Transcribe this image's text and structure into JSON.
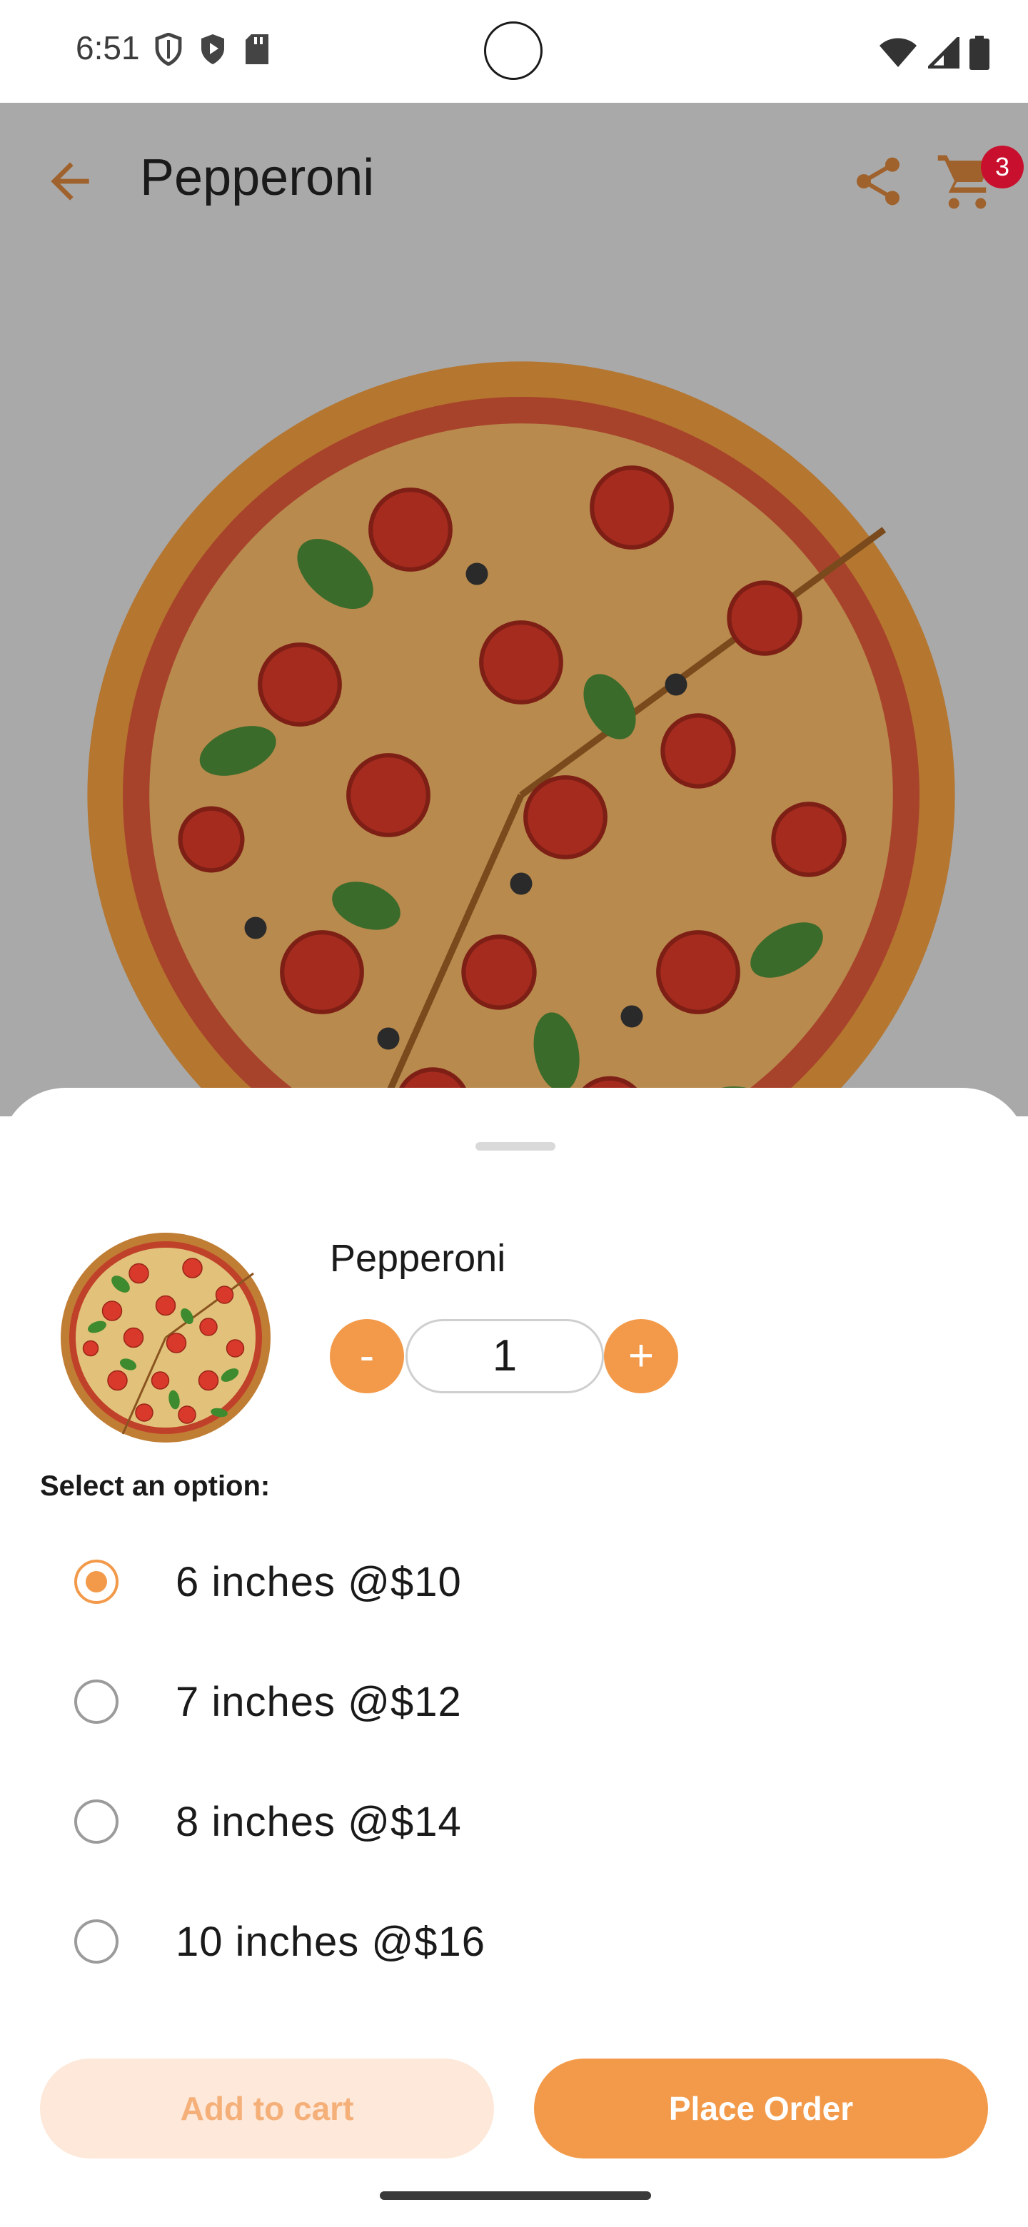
{
  "status_bar": {
    "time": "6:51"
  },
  "app_bar": {
    "title": "Pepperoni",
    "cart_count": "3"
  },
  "product": {
    "name": "Pepperoni",
    "quantity": "1",
    "minus_label": "-",
    "plus_label": "+"
  },
  "options": {
    "label": "Select an option:",
    "items": [
      {
        "label": "6 inches @$10",
        "selected": true
      },
      {
        "label": "7 inches @$12",
        "selected": false
      },
      {
        "label": "8 inches @$14",
        "selected": false
      },
      {
        "label": "10 inches @$16",
        "selected": false
      }
    ]
  },
  "actions": {
    "add_to_cart": "Add to cart",
    "place_order": "Place Order"
  },
  "colors": {
    "accent": "#f29a4a",
    "accent_light": "#fde8d9",
    "badge": "#c8102e",
    "overlay": "#a9a9a9"
  }
}
